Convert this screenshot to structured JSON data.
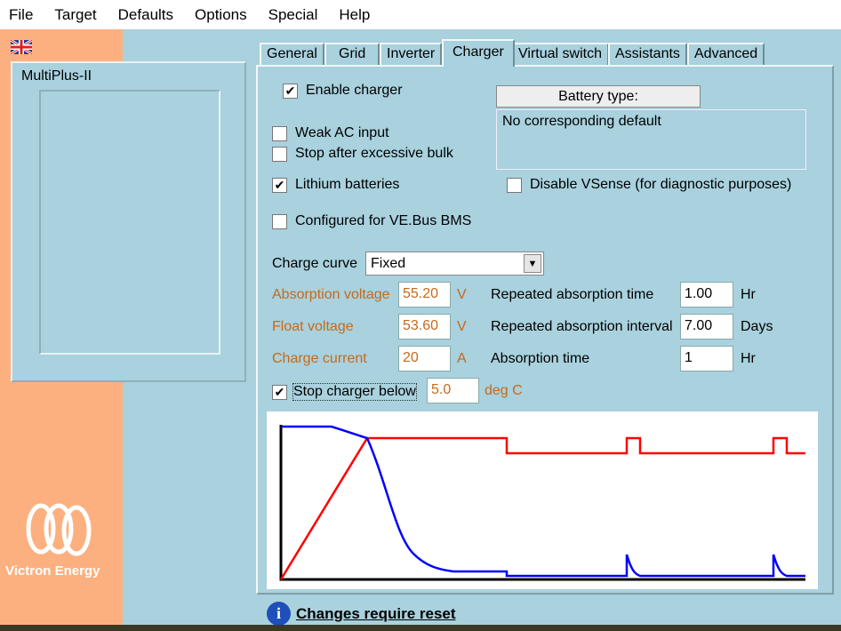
{
  "menu": [
    "File",
    "Target",
    "Defaults",
    "Options",
    "Special",
    "Help"
  ],
  "device": {
    "name": "MultiPlus-II"
  },
  "brand": "Victron Energy",
  "tabs": [
    "General",
    "Grid",
    "Inverter",
    "Charger",
    "Virtual switch",
    "Assistants",
    "Advanced"
  ],
  "active_tab": "Charger",
  "charger": {
    "enable_charger": {
      "label": "Enable charger",
      "checked": true
    },
    "weak_ac": {
      "label": "Weak AC input",
      "checked": false
    },
    "stop_bulk": {
      "label": "Stop after excessive bulk",
      "checked": false
    },
    "lithium": {
      "label": "Lithium batteries",
      "checked": true
    },
    "vebus_bms": {
      "label": "Configured for VE.Bus BMS",
      "checked": false
    },
    "disable_vsense": {
      "label": "Disable VSense (for diagnostic purposes)",
      "checked": false
    },
    "battery_type_button": "Battery type:",
    "battery_type_text": "No corresponding default",
    "charge_curve_label": "Charge curve",
    "charge_curve": "Fixed",
    "absorption_voltage": {
      "label": "Absorption voltage",
      "value": "55.20",
      "unit": "V"
    },
    "float_voltage": {
      "label": "Float voltage",
      "value": "53.60",
      "unit": "V"
    },
    "charge_current": {
      "label": "Charge current",
      "value": "20",
      "unit": "A"
    },
    "rep_abs_time": {
      "label": "Repeated absorption time",
      "value": "1.00",
      "unit": "Hr"
    },
    "rep_abs_interval": {
      "label": "Repeated absorption interval",
      "value": "7.00",
      "unit": "Days"
    },
    "abs_time": {
      "label": "Absorption time",
      "value": "1",
      "unit": "Hr"
    },
    "stop_below": {
      "label": "Stop charger below",
      "checked": true,
      "value": "5.0",
      "unit": "deg C"
    }
  },
  "footer": {
    "text": "Changes require reset"
  },
  "colors": {
    "voltage": "#ff0000",
    "current": "#0000ff",
    "orange_label": "#c56a1c"
  }
}
